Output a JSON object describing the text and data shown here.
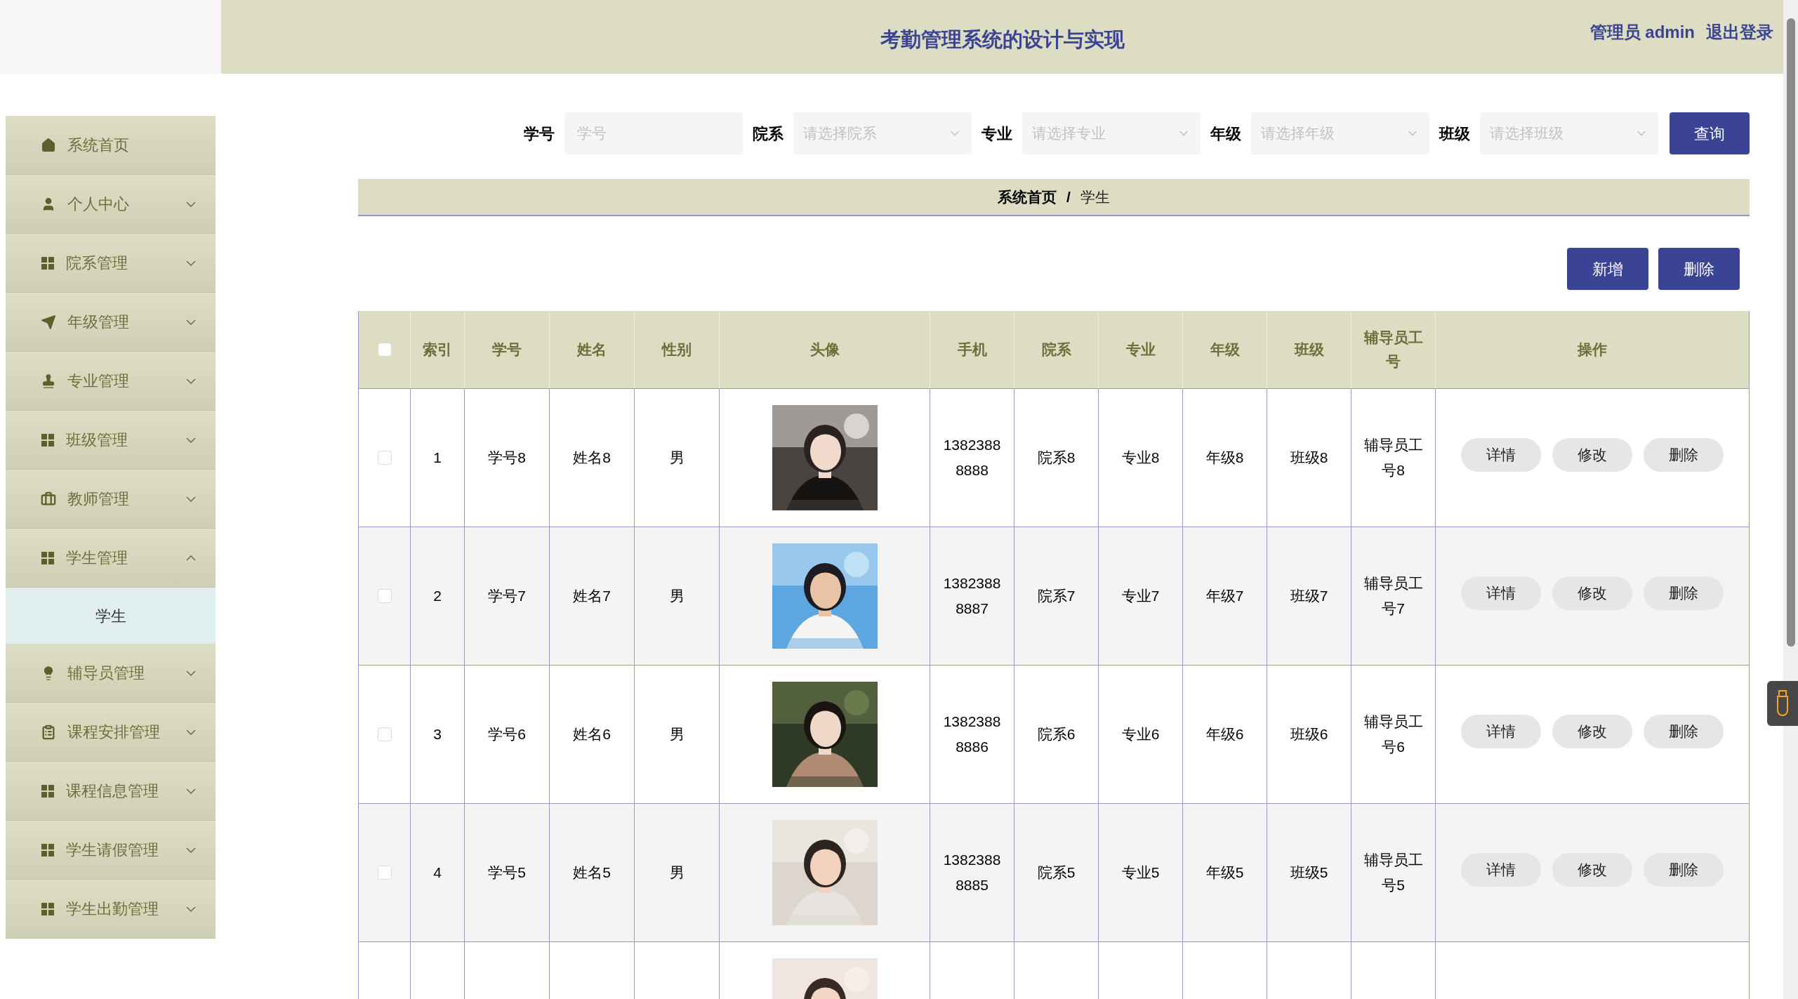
{
  "header": {
    "title": "考勤管理系统的设计与实现",
    "user_label": "管理员 admin",
    "logout": "退出登录"
  },
  "sidebar": {
    "items": [
      {
        "label": "系统首页",
        "kind": "link"
      },
      {
        "label": "个人中心",
        "kind": "menu",
        "expanded": false
      },
      {
        "label": "院系管理",
        "kind": "menu",
        "expanded": false
      },
      {
        "label": "年级管理",
        "kind": "menu",
        "expanded": false
      },
      {
        "label": "专业管理",
        "kind": "menu",
        "expanded": false
      },
      {
        "label": "班级管理",
        "kind": "menu",
        "expanded": false
      },
      {
        "label": "教师管理",
        "kind": "menu",
        "expanded": false
      },
      {
        "label": "学生管理",
        "kind": "menu",
        "expanded": true,
        "children": [
          {
            "label": "学生",
            "selected": true
          }
        ]
      },
      {
        "label": "辅导员管理",
        "kind": "menu",
        "expanded": false
      },
      {
        "label": "课程安排管理",
        "kind": "menu",
        "expanded": false
      },
      {
        "label": "课程信息管理",
        "kind": "menu",
        "expanded": false
      },
      {
        "label": "学生请假管理",
        "kind": "menu",
        "expanded": false
      },
      {
        "label": "学生出勤管理",
        "kind": "menu",
        "expanded": false
      }
    ]
  },
  "search": {
    "fields": [
      {
        "label": "学号",
        "placeholder": "学号",
        "kind": "text"
      },
      {
        "label": "院系",
        "placeholder": "请选择院系",
        "kind": "select"
      },
      {
        "label": "专业",
        "placeholder": "请选择专业",
        "kind": "select"
      },
      {
        "label": "年级",
        "placeholder": "请选择年级",
        "kind": "select"
      },
      {
        "label": "班级",
        "placeholder": "请选择班级",
        "kind": "select"
      }
    ],
    "button": "查询"
  },
  "breadcrumb": {
    "home": "系统首页",
    "separator": "/",
    "current": "学生"
  },
  "actions": [
    "新增",
    "删除"
  ],
  "table": {
    "select_all": false,
    "columns": [
      "索引",
      "学号",
      "姓名",
      "性别",
      "头像",
      "手机",
      "院系",
      "专业",
      "年级",
      "班级",
      "辅导员工号",
      "操作"
    ],
    "rows": [
      {
        "checked": false,
        "index": "1",
        "student_no": "学号8",
        "name": "姓名8",
        "gender": "男",
        "avatar": {
          "kind": "picture"
        },
        "phone": "13823888888",
        "department": "院系8",
        "major": "专业8",
        "grade": "年级8",
        "class": "班级8",
        "counselor_no": "辅导员工号8",
        "buttons": [
          "详情",
          "修改",
          "删除"
        ]
      },
      {
        "checked": false,
        "index": "2",
        "student_no": "学号7",
        "name": "姓名7",
        "gender": "男",
        "avatar": {
          "kind": "picture"
        },
        "phone": "13823888887",
        "department": "院系7",
        "major": "专业7",
        "grade": "年级7",
        "class": "班级7",
        "counselor_no": "辅导员工号7",
        "buttons": [
          "详情",
          "修改",
          "删除"
        ]
      },
      {
        "checked": false,
        "index": "3",
        "student_no": "学号6",
        "name": "姓名6",
        "gender": "男",
        "avatar": {
          "kind": "picture"
        },
        "phone": "13823888886",
        "department": "院系6",
        "major": "专业6",
        "grade": "年级6",
        "class": "班级6",
        "counselor_no": "辅导员工号6",
        "buttons": [
          "详情",
          "修改",
          "删除"
        ]
      },
      {
        "checked": false,
        "index": "4",
        "student_no": "学号5",
        "name": "姓名5",
        "gender": "男",
        "avatar": {
          "kind": "picture"
        },
        "phone": "13823888885",
        "department": "院系5",
        "major": "专业5",
        "grade": "年级5",
        "class": "班级5",
        "counselor_no": "辅导员工号5",
        "buttons": [
          "详情",
          "修改",
          "删除"
        ]
      }
    ],
    "cut_row": {
      "avatar": {
        "kind": "picture"
      }
    }
  }
}
